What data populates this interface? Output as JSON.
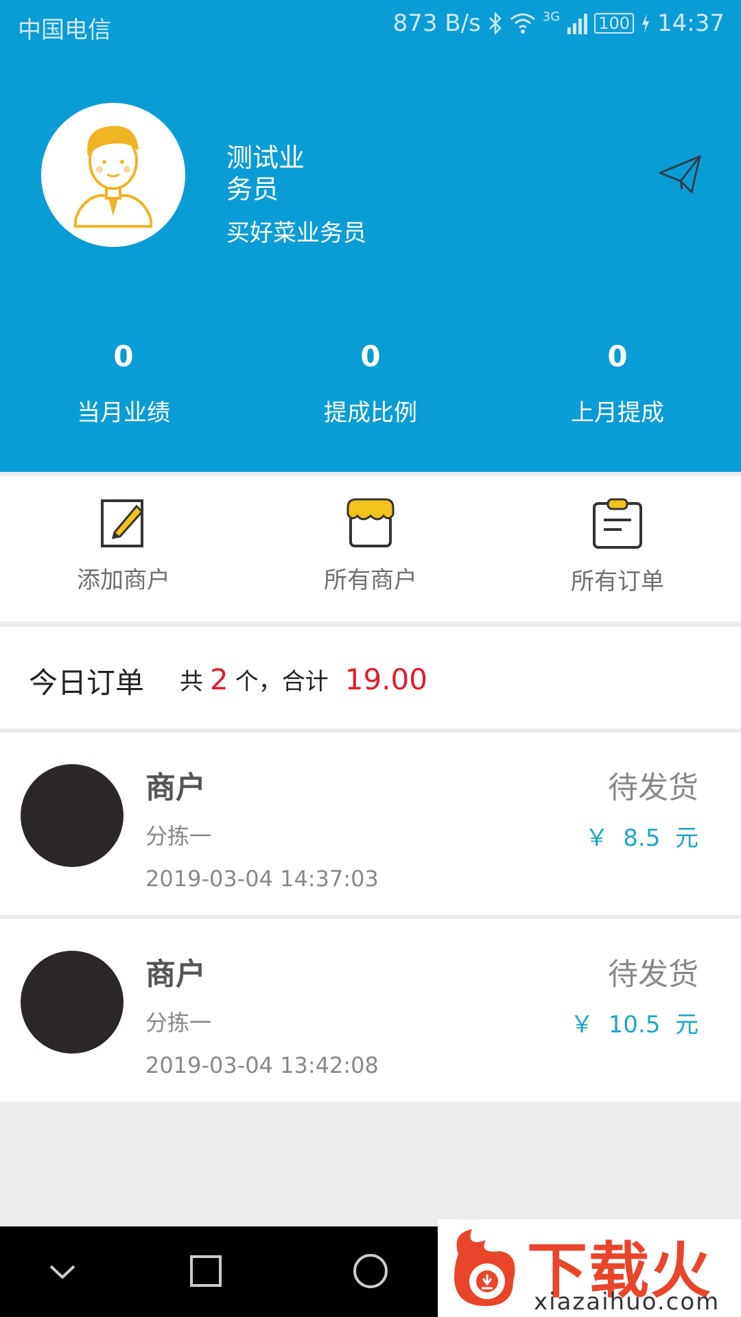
{
  "statusbar": {
    "carrier": "中国电信",
    "speed": "873 B/s",
    "network": "3G",
    "battery": "100",
    "time": "14:37"
  },
  "profile": {
    "name": "测试业务员",
    "role": "买好菜业务员"
  },
  "stats": [
    {
      "value": "0",
      "label": "当月业绩"
    },
    {
      "value": "0",
      "label": "提成比例"
    },
    {
      "value": "0",
      "label": "上月提成"
    }
  ],
  "actions": [
    {
      "label": "添加商户",
      "icon": "edit-icon"
    },
    {
      "label": "所有商户",
      "icon": "store-icon"
    },
    {
      "label": "所有订单",
      "icon": "clipboard-icon"
    }
  ],
  "today": {
    "title": "今日订单",
    "prefix": "共",
    "count": "2",
    "mid": "个，合计",
    "total": "19.00"
  },
  "orders": [
    {
      "merchant": "商户",
      "sub": "分拣一",
      "time": "2019-03-04 14:37:03",
      "status": "待发货",
      "price": "￥  8.5  元"
    },
    {
      "merchant": "商户",
      "sub": "分拣一",
      "time": "2019-03-04 13:42:08",
      "status": "待发货",
      "price": "￥  10.5  元"
    }
  ],
  "watermark": {
    "main": "下载火",
    "sub": "xiazaihuo.com"
  },
  "colors": {
    "header": "#0a9cd4",
    "accent_red": "#e21b2b",
    "price_blue": "#1aa6c4"
  }
}
